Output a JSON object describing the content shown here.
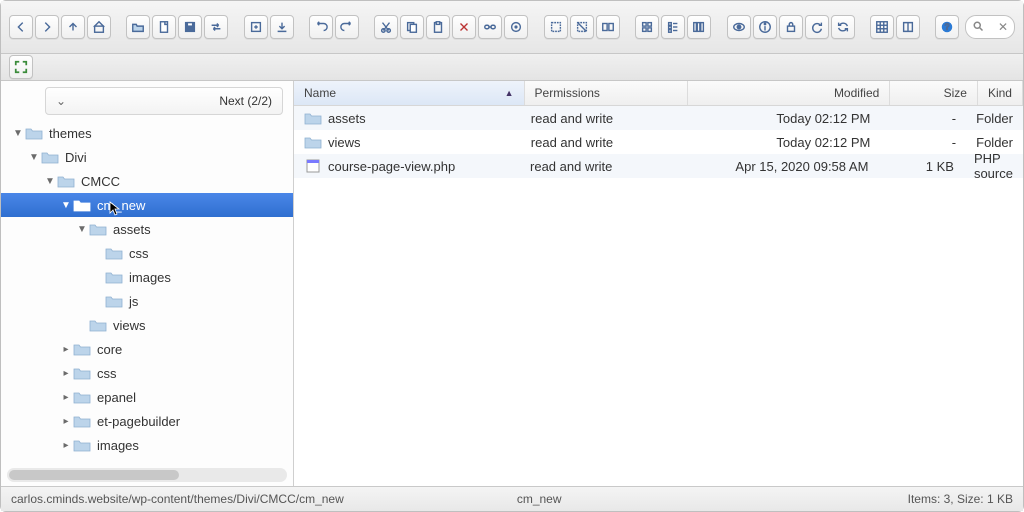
{
  "toolbar_icons": [
    "back",
    "forward",
    "up",
    "home",
    "new-folder",
    "new-file",
    "save",
    "transfer",
    "open",
    "download",
    "undo",
    "redo",
    "cut",
    "copy",
    "paste",
    "delete",
    "link",
    "target",
    "select-all",
    "select-none",
    "compare",
    "view-icons",
    "view-list",
    "view-columns",
    "preview",
    "info",
    "permissions",
    "refresh",
    "sync",
    "grid",
    "book",
    "help"
  ],
  "second_toolbar_icon": "expand",
  "findbar": {
    "label": "Next (2/2)"
  },
  "tree": [
    {
      "depth": 0,
      "disclosure": "▼",
      "label": "themes"
    },
    {
      "depth": 1,
      "disclosure": "▼",
      "label": "Divi"
    },
    {
      "depth": 2,
      "disclosure": "▼",
      "label": "CMCC"
    },
    {
      "depth": 3,
      "disclosure": "▼",
      "label": "cm_new",
      "selected": true,
      "cursor": true
    },
    {
      "depth": 4,
      "disclosure": "▼",
      "label": "assets"
    },
    {
      "depth": 5,
      "disclosure": "",
      "label": "css"
    },
    {
      "depth": 5,
      "disclosure": "",
      "label": "images"
    },
    {
      "depth": 5,
      "disclosure": "",
      "label": "js"
    },
    {
      "depth": 4,
      "disclosure": "",
      "label": "views"
    },
    {
      "depth": 3,
      "disclosure": "▸",
      "label": "core"
    },
    {
      "depth": 3,
      "disclosure": "▸",
      "label": "css"
    },
    {
      "depth": 3,
      "disclosure": "▸",
      "label": "epanel"
    },
    {
      "depth": 3,
      "disclosure": "▸",
      "label": "et-pagebuilder"
    },
    {
      "depth": 3,
      "disclosure": "▸",
      "label": "images"
    }
  ],
  "columns": {
    "name": "Name",
    "permissions": "Permissions",
    "modified": "Modified",
    "size": "Size",
    "kind": "Kind"
  },
  "files": [
    {
      "icon": "folder",
      "name": "assets",
      "perm": "read and write",
      "mod": "Today 02:12 PM",
      "size": "-",
      "kind": "Folder"
    },
    {
      "icon": "folder",
      "name": "views",
      "perm": "read and write",
      "mod": "Today 02:12 PM",
      "size": "-",
      "kind": "Folder"
    },
    {
      "icon": "php",
      "name": "course-page-view.php",
      "perm": "read and write",
      "mod": "Apr 15, 2020 09:58 AM",
      "size": "1 KB",
      "kind": "PHP source"
    }
  ],
  "status": {
    "path": "carlos.cminds.website/wp-content/themes/Divi/CMCC/cm_new",
    "current": "cm_new",
    "summary": "Items: 3, Size: 1 KB"
  },
  "colors": {
    "folder_fill": "#bcd4ea",
    "folder_stroke": "#8fb1d1",
    "selection": "#2f6fd0"
  }
}
